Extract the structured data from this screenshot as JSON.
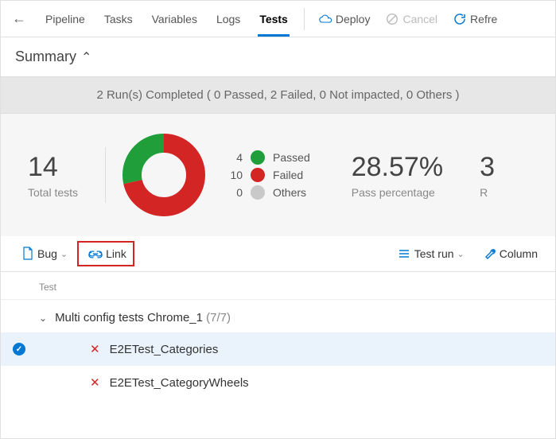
{
  "nav": {
    "tabs": [
      "Pipeline",
      "Tasks",
      "Variables",
      "Logs",
      "Tests"
    ],
    "active_index": 4,
    "deploy": "Deploy",
    "cancel": "Cancel",
    "refresh": "Refre"
  },
  "summary": {
    "title": "Summary",
    "runs_text": "2 Run(s) Completed ( 0 Passed, 2 Failed, 0 Not impacted, 0 Others )"
  },
  "stats": {
    "total_tests_value": "14",
    "total_tests_label": "Total tests",
    "pass_pct_value": "28.57%",
    "pass_pct_label": "Pass percentage",
    "extra_num": "3",
    "extra_label": "R",
    "legend": {
      "passed_count": "4",
      "passed_label": "Passed",
      "failed_count": "10",
      "failed_label": "Failed",
      "others_count": "0",
      "others_label": "Others"
    }
  },
  "toolbar": {
    "bug": "Bug",
    "link": "Link",
    "testrun": "Test run",
    "column": "Column"
  },
  "tests": {
    "col_head": "Test",
    "group_name": "Multi config tests Chrome_1",
    "group_count": "(7/7)",
    "rows": [
      {
        "name": "E2ETest_Categories",
        "selected": true,
        "status": "failed"
      },
      {
        "name": "E2ETest_CategoryWheels",
        "selected": false,
        "status": "failed"
      }
    ]
  },
  "chart_data": {
    "type": "pie",
    "title": "",
    "series": [
      {
        "name": "Passed",
        "value": 4,
        "color": "#1f9e3a"
      },
      {
        "name": "Failed",
        "value": 10,
        "color": "#d42525"
      },
      {
        "name": "Others",
        "value": 0,
        "color": "#c9c9c9"
      }
    ]
  }
}
